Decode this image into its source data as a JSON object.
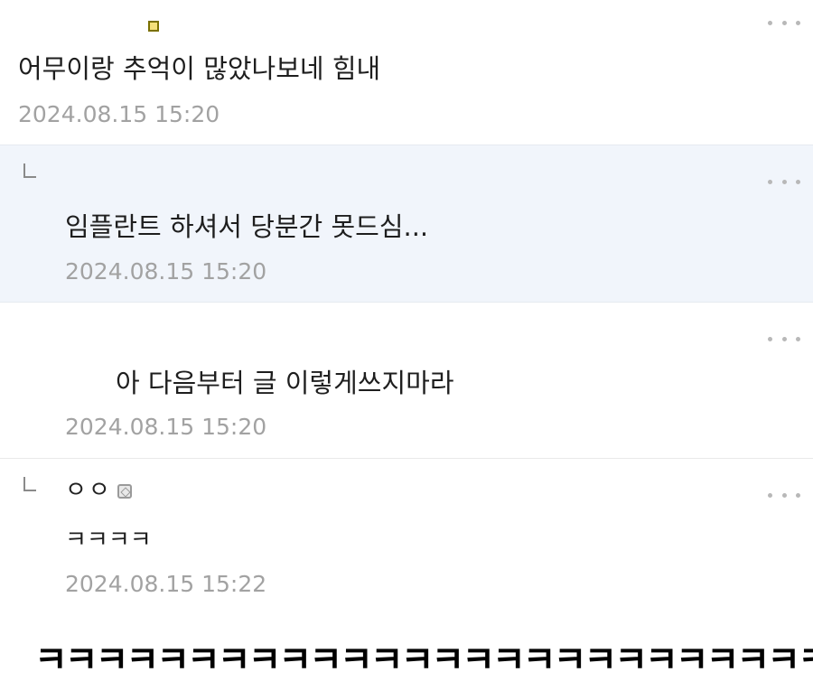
{
  "comments": [
    {
      "body": "어무이랑 추억이 많았나보네 힘내",
      "date": "2024.08.15 15:20"
    },
    {
      "body": "임플란트 하셔서 당분간 못드심...",
      "date": "2024.08.15 15:20"
    },
    {
      "body": "아 다음부터 글 이렇게쓰지마라",
      "date": "2024.08.15 15:20"
    },
    {
      "nickname": "ㅇㅇ",
      "body": "ㅋㅋㅋㅋ",
      "date": "2024.08.15 15:22"
    }
  ],
  "caption": "ㅋㅋㅋㅋㅋㅋㅋㅋㅋㅋㅋㅋㅋㅋㅋㅋㅋㅋㅋㅋㅋㅋㅋㅋㅋㅋㅋㅋㅋㅋ",
  "icons": {
    "more": "more-dots-icon",
    "reply": "reply-arrow-icon",
    "emoji": "emoji-icon",
    "sticker": "sticker-icon"
  },
  "colors": {
    "reply_highlight_bg": "#f1f5fb",
    "date_text": "#a2a2a2",
    "body_text": "#1e1e1e"
  }
}
